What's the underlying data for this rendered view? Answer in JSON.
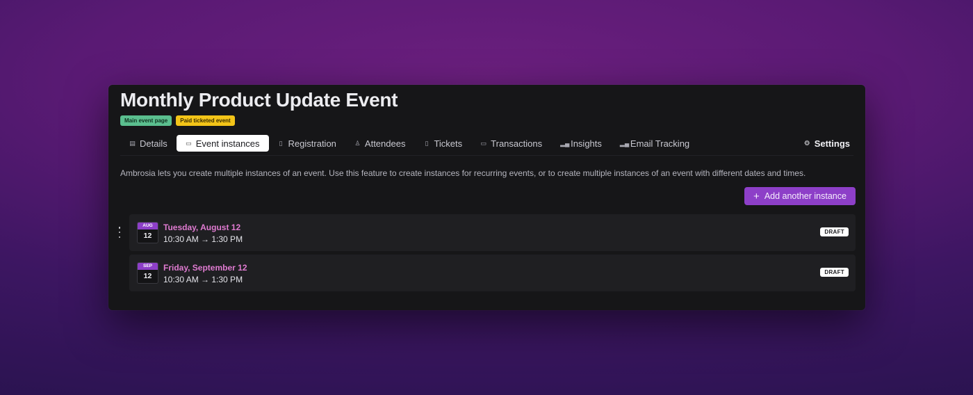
{
  "event": {
    "title": "Monthly Product Update Event",
    "badges": [
      "Main event page",
      "Paid ticketed event"
    ]
  },
  "tabs": [
    {
      "label": "Details",
      "icon": "document-icon",
      "active": false
    },
    {
      "label": "Event instances",
      "icon": "calendar-icon",
      "active": true
    },
    {
      "label": "Registration",
      "icon": "clipboard-icon",
      "active": false
    },
    {
      "label": "Attendees",
      "icon": "person-icon",
      "active": false
    },
    {
      "label": "Tickets",
      "icon": "ticket-icon",
      "active": false
    },
    {
      "label": "Transactions",
      "icon": "card-icon",
      "active": false
    },
    {
      "label": "Insights",
      "icon": "bar-chart-icon",
      "active": false
    },
    {
      "label": "Email Tracking",
      "icon": "bar-chart-icon",
      "active": false
    }
  ],
  "settings_label": "Settings",
  "description": "Ambrosia lets you create multiple instances of an event. Use this feature to create instances for recurring events, or to create multiple instances of an event with different dates and times.",
  "add_button_label": "Add another instance",
  "instances": [
    {
      "month": "AUG",
      "day": "12",
      "date_label": "Tuesday, August 12",
      "time_label": "10:30 AM → 1:30 PM",
      "status": "DRAFT"
    },
    {
      "month": "SEP",
      "day": "12",
      "date_label": "Friday, September 12",
      "time_label": "10:30 AM → 1:30 PM",
      "status": "DRAFT"
    }
  ],
  "colors": {
    "accent": "#8d3fc8",
    "date_pink": "#e07bd1",
    "badge_green": "#5bbf8f",
    "badge_yellow": "#f3c418"
  }
}
